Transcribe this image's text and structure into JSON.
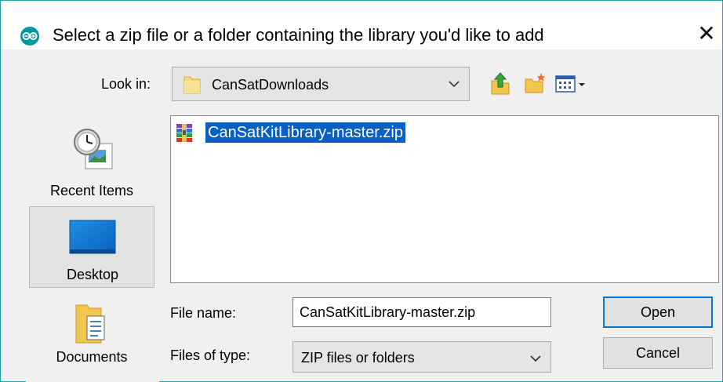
{
  "window": {
    "title": "Select a zip file or a folder containing the library you'd like to add",
    "close_glyph": "✕",
    "accent_color": "#1a9fa6"
  },
  "look_in": {
    "label": "Look in:",
    "value": "CanSatDownloads",
    "toolbar_icons": [
      "up-folder-icon",
      "new-folder-icon",
      "view-menu-icon"
    ]
  },
  "places": [
    {
      "label": "Recent Items",
      "icon": "recent-items-icon",
      "selected": false
    },
    {
      "label": "Desktop",
      "icon": "desktop-icon",
      "selected": true
    },
    {
      "label": "Documents",
      "icon": "documents-icon",
      "selected": false
    }
  ],
  "files": [
    {
      "name": "CanSatKitLibrary-master.zip",
      "icon": "zip-archive-icon",
      "selected": true
    }
  ],
  "file_name": {
    "label": "File name:",
    "value": "CanSatKitLibrary-master.zip"
  },
  "file_type": {
    "label": "Files of type:",
    "value": "ZIP files or folders"
  },
  "buttons": {
    "open": "Open",
    "cancel": "Cancel"
  },
  "colors": {
    "selection": "#0a5fc4",
    "default_button_border": "#0078d7"
  }
}
